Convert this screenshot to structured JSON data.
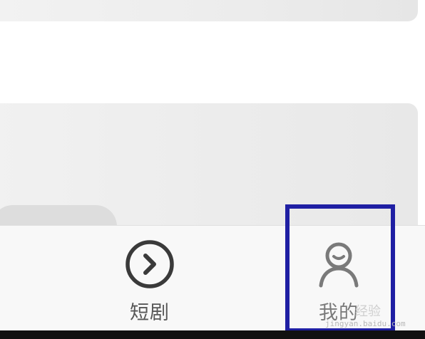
{
  "tab_bar": {
    "duanju": {
      "label": "短剧",
      "icon": "chevron-right-circle-icon"
    },
    "wode": {
      "label": "我的",
      "icon": "user-icon",
      "highlighted": true
    }
  },
  "annotation": {
    "box_color": "#1f1fa3"
  },
  "watermark": {
    "brand": "经验",
    "url": "jingyan.baidu.com"
  }
}
